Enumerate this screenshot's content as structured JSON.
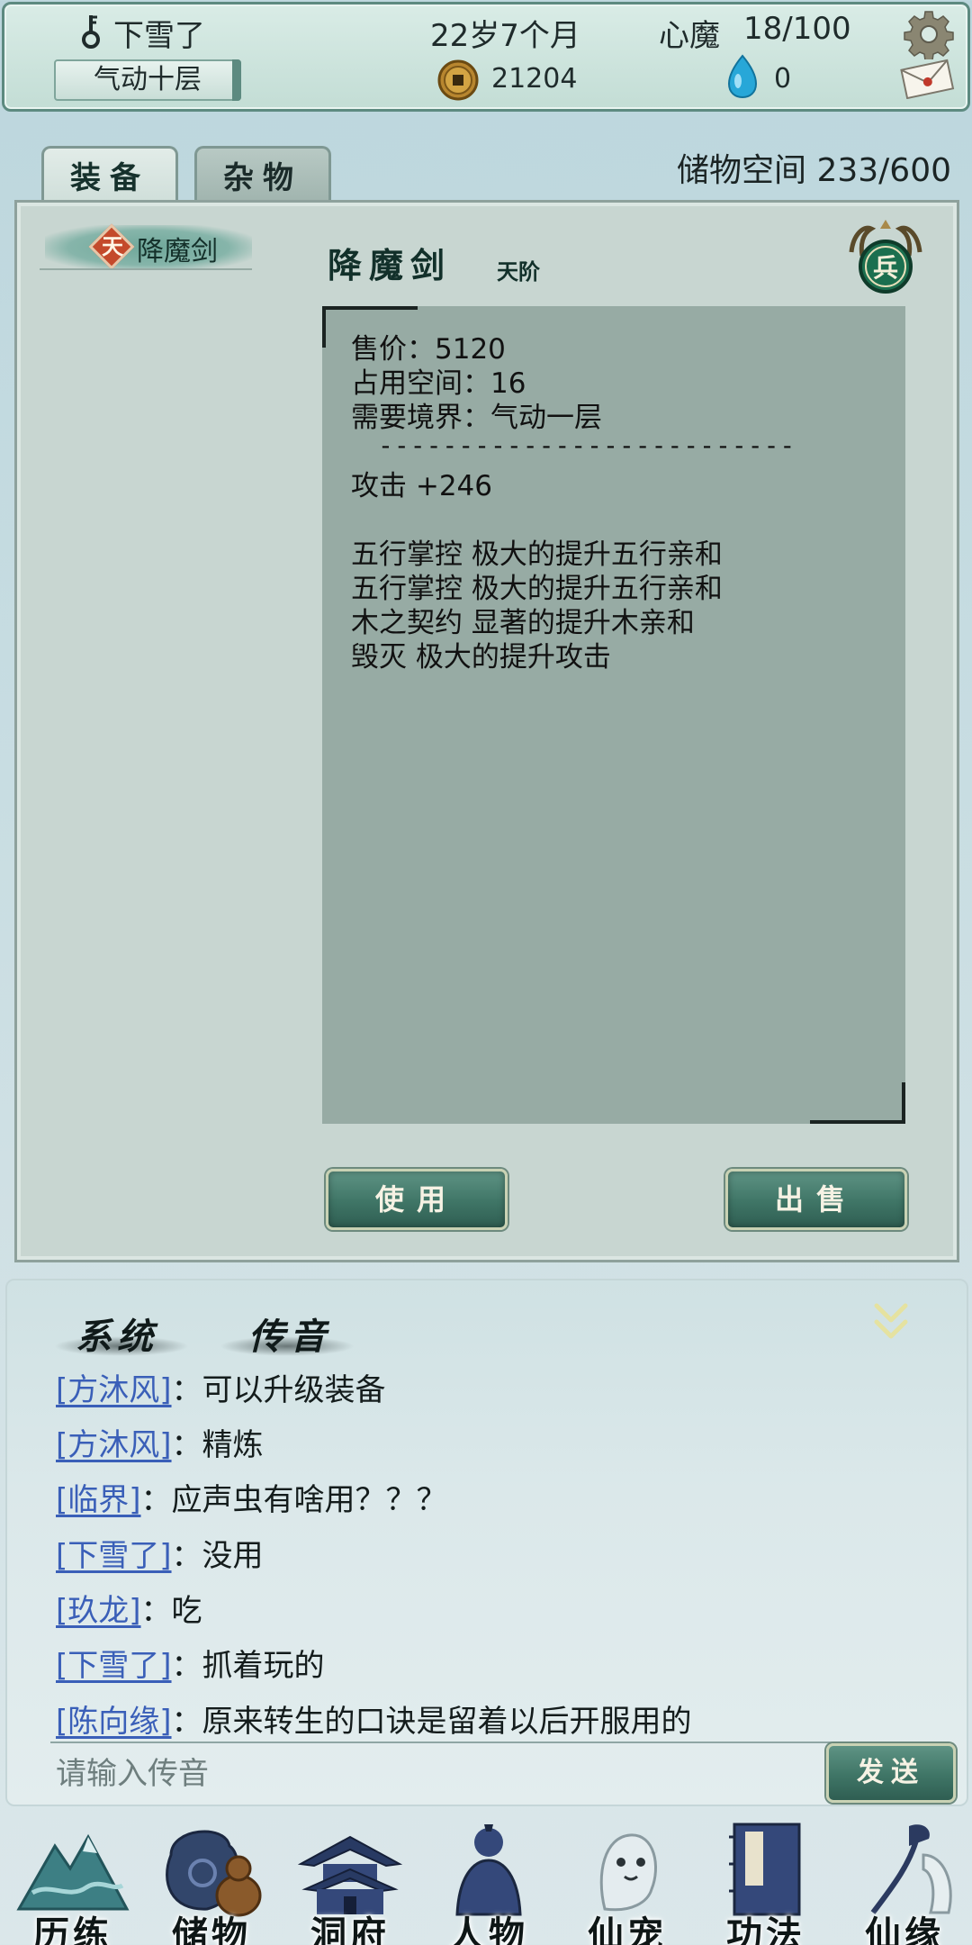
{
  "header": {
    "player_name": "下雪了",
    "age": "22岁7个月",
    "heart_demon_label": "心魔",
    "heart_demon_value": "18/100",
    "realm": "气动十层",
    "coins": "21204",
    "spirit_stones": "0"
  },
  "storage": {
    "tabs": [
      {
        "label": "装备",
        "active": true
      },
      {
        "label": "杂物",
        "active": false
      }
    ],
    "capacity_label": "储物空间 233/600",
    "item_list": [
      {
        "grade_char": "天",
        "name": "降魔剑"
      }
    ],
    "selected_item": {
      "name": "降魔剑",
      "grade": "天阶",
      "type_badge": "兵",
      "price": "售价：5120",
      "space": "占用空间：16",
      "realm_required": "需要境界：气动一层",
      "divider": "--------------------------",
      "attack": "攻击 +246",
      "effects": [
        "五行掌控 极大的提升五行亲和",
        "五行掌控 极大的提升五行亲和",
        "木之契约 显著的提升木亲和",
        "毁灭 极大的提升攻击"
      ]
    },
    "use_button": "使用",
    "sell_button": "出售"
  },
  "chat": {
    "tabs": [
      "系统",
      "传音"
    ],
    "messages": [
      {
        "name": "[方沐风]",
        "text": "：可以升级装备"
      },
      {
        "name": "[方沐风]",
        "text": "：精炼"
      },
      {
        "name": "[临界]",
        "text": "：应声虫有啥用？？？"
      },
      {
        "name": "[下雪了]",
        "text": "：没用"
      },
      {
        "name": "[玖龙]",
        "text": "：吃"
      },
      {
        "name": "[下雪了]",
        "text": "：抓着玩的"
      },
      {
        "name": "[陈向缘]",
        "text": "：原来转生的口诀是留着以后开服用的"
      }
    ],
    "input_placeholder": "请输入传音",
    "send_button": "发送"
  },
  "nav": [
    {
      "label": "历练",
      "icon": "mountain-icon"
    },
    {
      "label": "储物",
      "icon": "pouch-gourd-icon"
    },
    {
      "label": "洞府",
      "icon": "pagoda-icon"
    },
    {
      "label": "人物",
      "icon": "person-icon"
    },
    {
      "label": "仙宠",
      "icon": "spirit-pet-icon"
    },
    {
      "label": "功法",
      "icon": "scroll-book-icon"
    },
    {
      "label": "仙缘",
      "icon": "crane-icon"
    }
  ],
  "colors": {
    "accent_green": "#3f7566",
    "chat_name_blue": "#3a5fb8",
    "panel_bg": "#c8d6d1",
    "detail_bg": "#97aba4"
  }
}
